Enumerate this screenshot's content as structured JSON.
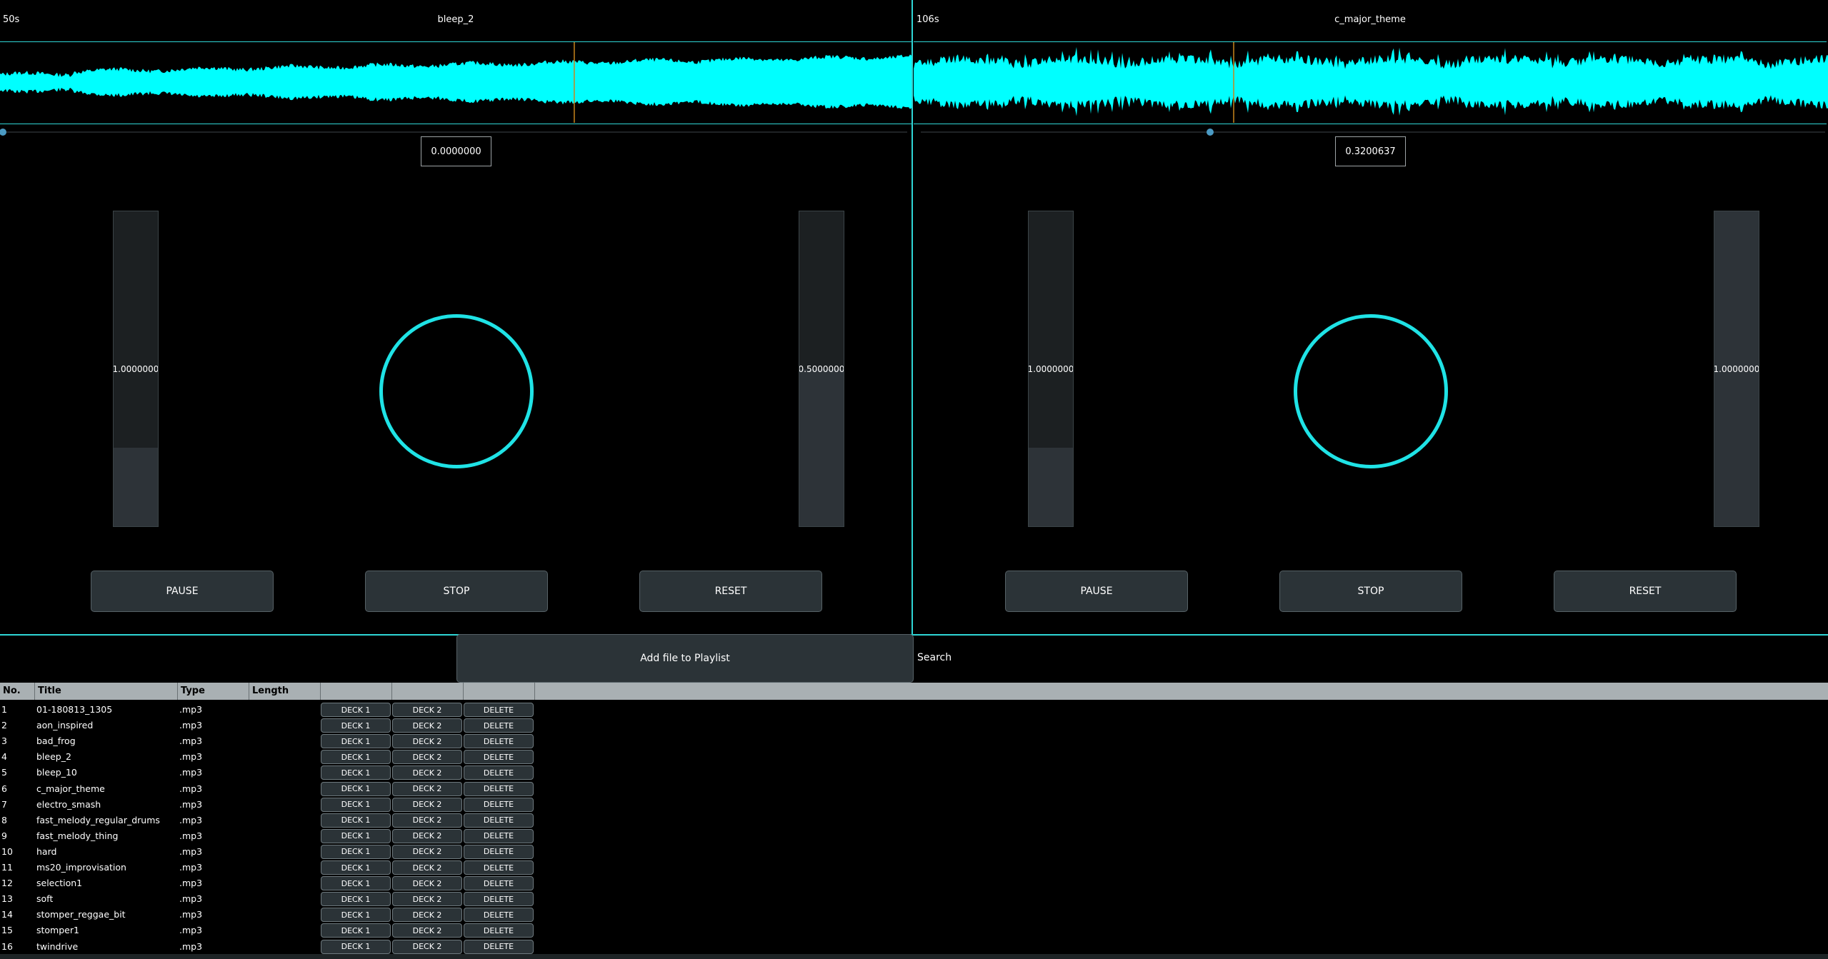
{
  "decks": [
    {
      "duration_label": "50s",
      "title": "bleep_2",
      "position_value": "0.0000000",
      "position": 0.0,
      "playhead": 0.63,
      "left_slider": {
        "label": "1.0000000",
        "fill": 0.25
      },
      "right_slider": {
        "label": "0.5000000",
        "fill": 0.5
      },
      "buttons": {
        "pause": "PAUSE",
        "stop": "STOP",
        "reset": "RESET"
      }
    },
    {
      "duration_label": "106s",
      "title": "c_major_theme",
      "position_value": "0.3200637",
      "position": 0.32,
      "playhead": 0.35,
      "left_slider": {
        "label": "1.0000000",
        "fill": 0.25
      },
      "right_slider": {
        "label": "1.0000000",
        "fill": 1.0
      },
      "buttons": {
        "pause": "PAUSE",
        "stop": "STOP",
        "reset": "RESET"
      }
    }
  ],
  "playlist_controls": {
    "add_file_label": "Add file to Playlist",
    "search_label": "Search"
  },
  "playlist": {
    "columns": [
      "No.",
      "Title",
      "Type",
      "Length",
      "",
      "",
      ""
    ],
    "row_buttons": {
      "deck1": "DECK 1",
      "deck2": "DECK 2",
      "delete": "DELETE"
    },
    "rows": [
      {
        "no": "1",
        "title": "01-180813_1305",
        "type": ".mp3",
        "length": ""
      },
      {
        "no": "2",
        "title": "aon_inspired",
        "type": ".mp3",
        "length": ""
      },
      {
        "no": "3",
        "title": "bad_frog",
        "type": ".mp3",
        "length": ""
      },
      {
        "no": "4",
        "title": "bleep_2",
        "type": ".mp3",
        "length": ""
      },
      {
        "no": "5",
        "title": "bleep_10",
        "type": ".mp3",
        "length": ""
      },
      {
        "no": "6",
        "title": "c_major_theme",
        "type": ".mp3",
        "length": ""
      },
      {
        "no": "7",
        "title": "electro_smash",
        "type": ".mp3",
        "length": ""
      },
      {
        "no": "8",
        "title": "fast_melody_regular_drums",
        "type": ".mp3",
        "length": ""
      },
      {
        "no": "9",
        "title": "fast_melody_thing",
        "type": ".mp3",
        "length": ""
      },
      {
        "no": "10",
        "title": "hard",
        "type": ".mp3",
        "length": ""
      },
      {
        "no": "11",
        "title": "ms20_improvisation",
        "type": ".mp3",
        "length": ""
      },
      {
        "no": "12",
        "title": "selection1",
        "type": ".mp3",
        "length": ""
      },
      {
        "no": "13",
        "title": "soft",
        "type": ".mp3",
        "length": ""
      },
      {
        "no": "14",
        "title": "stomper_reggae_bit",
        "type": ".mp3",
        "length": ""
      },
      {
        "no": "15",
        "title": "stomper1",
        "type": ".mp3",
        "length": ""
      },
      {
        "no": "16",
        "title": "twindrive",
        "type": ".mp3",
        "length": ""
      }
    ]
  },
  "colors": {
    "accent": "#2fd6d6",
    "waveform": "#00ffff",
    "platter": "#1fe3e6",
    "playhead": "#c8841c"
  }
}
